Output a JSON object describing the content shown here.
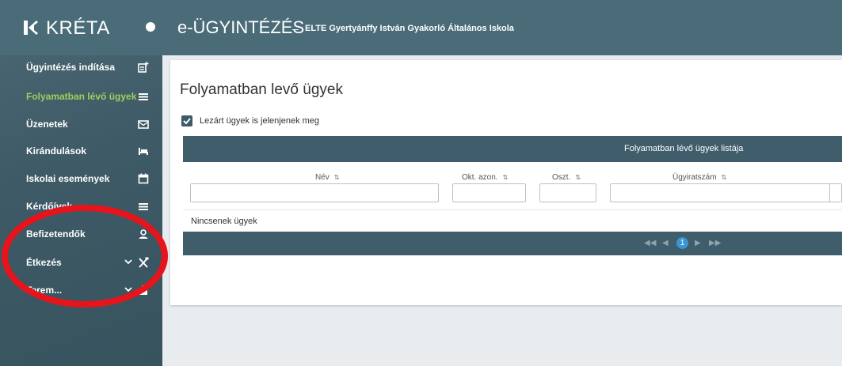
{
  "brand": {
    "name": "KRÉTA"
  },
  "header": {
    "app_title": "e-ÜGYINTÉZÉS",
    "separator": "–",
    "school": "ELTE Gyertyánffy István Gyakorló Általános Iskola"
  },
  "sidebar": {
    "items": [
      {
        "label": "Ügyintézés indítása",
        "icon": "document-add-icon",
        "active": false
      },
      {
        "label": "Folyamatban lévő ügyek",
        "icon": "list-icon",
        "active": true
      },
      {
        "label": "Üzenetek",
        "icon": "mail-icon",
        "active": false
      },
      {
        "label": "Kirándulások",
        "icon": "bed-icon",
        "active": false
      },
      {
        "label": "Iskolai események",
        "icon": "calendar-icon",
        "active": false
      },
      {
        "label": "Kérdőívek",
        "icon": "list-icon",
        "active": false
      },
      {
        "label": "Befizetendők",
        "icon": "user-payment-icon",
        "active": false
      },
      {
        "label": "Étkezés",
        "icon": "cutlery-icon",
        "active": false
      },
      {
        "label": "Terem...",
        "icon": "room-icon",
        "active": false
      }
    ]
  },
  "main": {
    "title": "Folyamatban levő ügyek",
    "show_closed_label": "Lezárt ügyek is jelenjenek meg",
    "show_closed_checked": true,
    "grid": {
      "title": "Folyamatban lévő ügyek listája",
      "columns": [
        "Név",
        "Okt. azon.",
        "Oszt.",
        "Ügyiratszám"
      ],
      "empty_text": "Nincsenek ügyek",
      "pager": {
        "current_page": "1"
      }
    }
  },
  "colors": {
    "sidebar": "#3e5a66",
    "header": "#4a6b78",
    "active_item": "#9ed05a",
    "grid_header": "#3f5d6a",
    "page_badge": "#3a95d3",
    "annotation": "#e8141b"
  }
}
